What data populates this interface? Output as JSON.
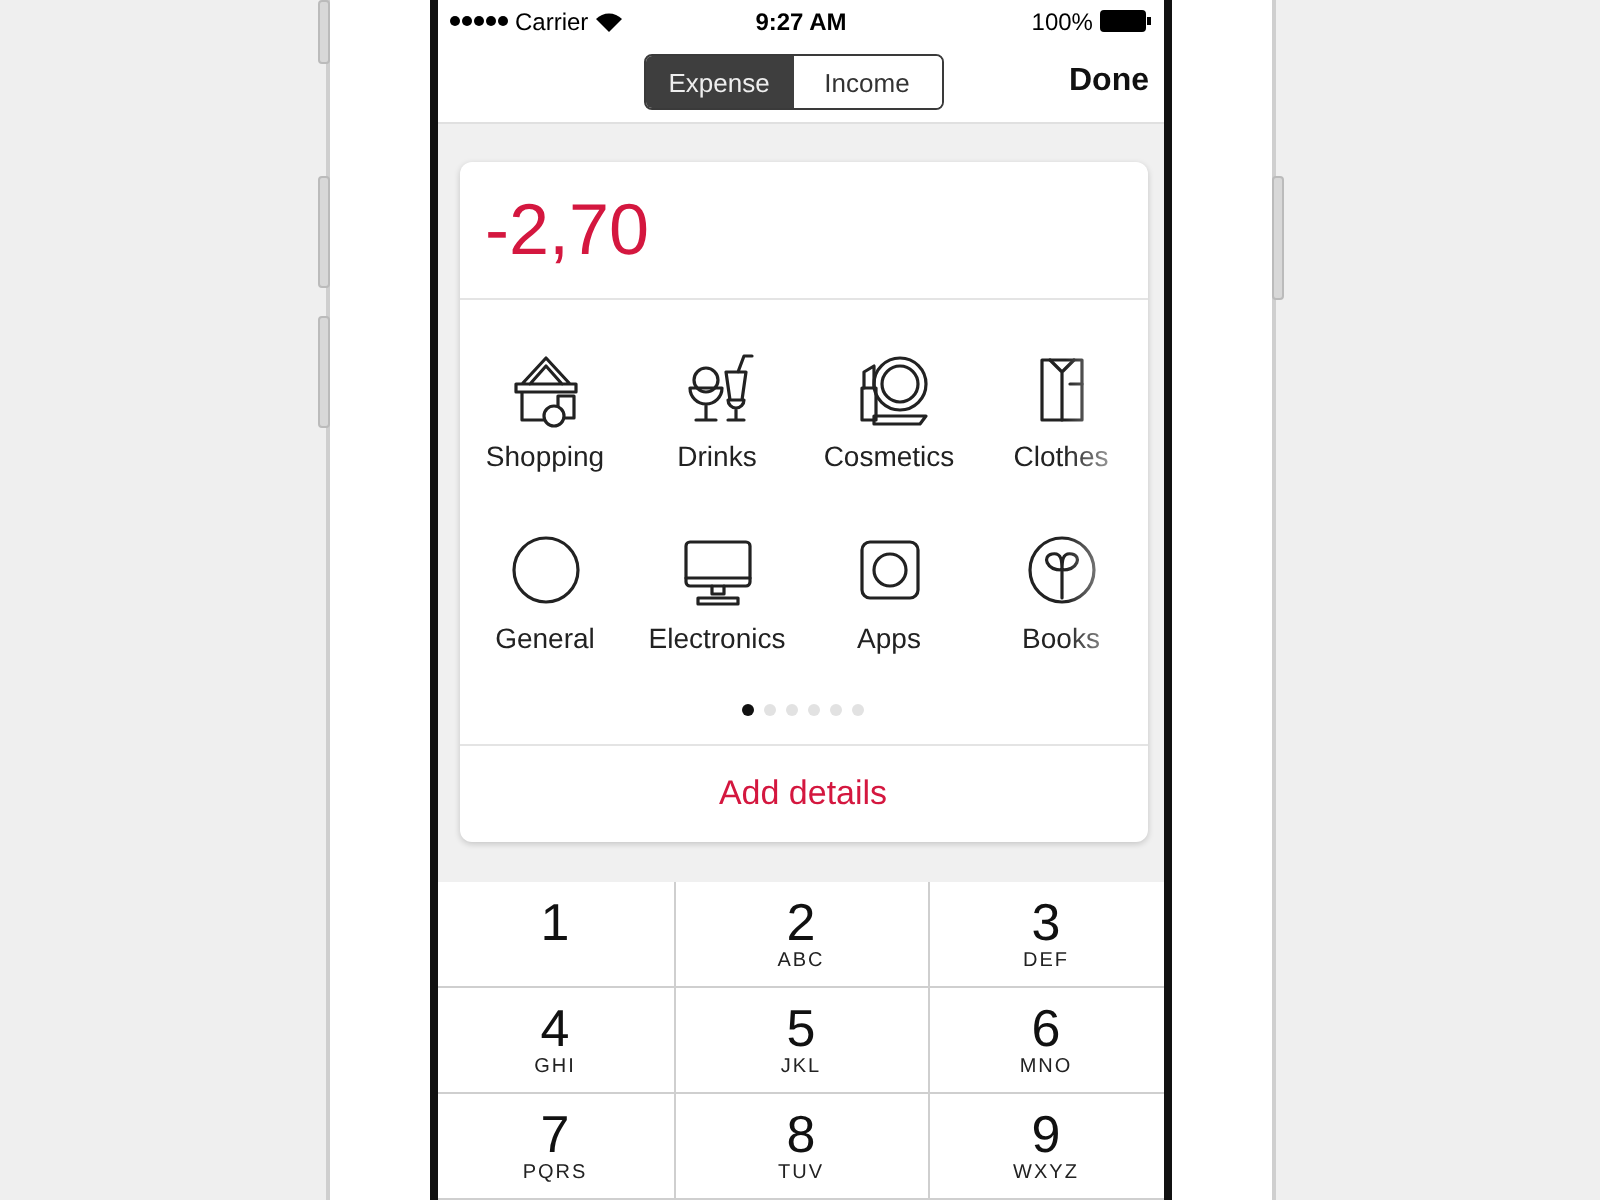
{
  "status_bar": {
    "carrier": "Carrier",
    "time": "9:27 AM",
    "battery": "100%"
  },
  "nav": {
    "segments": [
      {
        "label": "Expense",
        "selected": true
      },
      {
        "label": "Income",
        "selected": false
      }
    ],
    "done": "Done"
  },
  "amount": "-2,70",
  "categories": [
    {
      "label": "Shopping",
      "kind": "shopping"
    },
    {
      "label": "Drinks",
      "kind": "drinks"
    },
    {
      "label": "Cosmetics",
      "kind": "cosmetics"
    },
    {
      "label": "Clothes",
      "kind": "clothes"
    },
    {
      "label": "General",
      "kind": "general"
    },
    {
      "label": "Electronics",
      "kind": "electronics"
    },
    {
      "label": "Apps",
      "kind": "apps"
    },
    {
      "label": "Books",
      "kind": "books"
    }
  ],
  "pages": [
    {
      "selected": true
    },
    {
      "selected": false
    },
    {
      "selected": false
    },
    {
      "selected": false
    },
    {
      "selected": false
    },
    {
      "selected": false
    }
  ],
  "add_details": "Add details",
  "keypad": [
    {
      "digit": "1"
    },
    {
      "digit": "2",
      "letters": "ABC"
    },
    {
      "digit": "3",
      "letters": "DEF"
    },
    {
      "digit": "4",
      "letters": "GHI"
    },
    {
      "digit": "5",
      "letters": "JKL"
    },
    {
      "digit": "6",
      "letters": "MNO"
    },
    {
      "digit": "7",
      "letters": "PQRS"
    },
    {
      "digit": "8",
      "letters": "TUV"
    },
    {
      "digit": "9",
      "letters": "WXYZ"
    }
  ]
}
